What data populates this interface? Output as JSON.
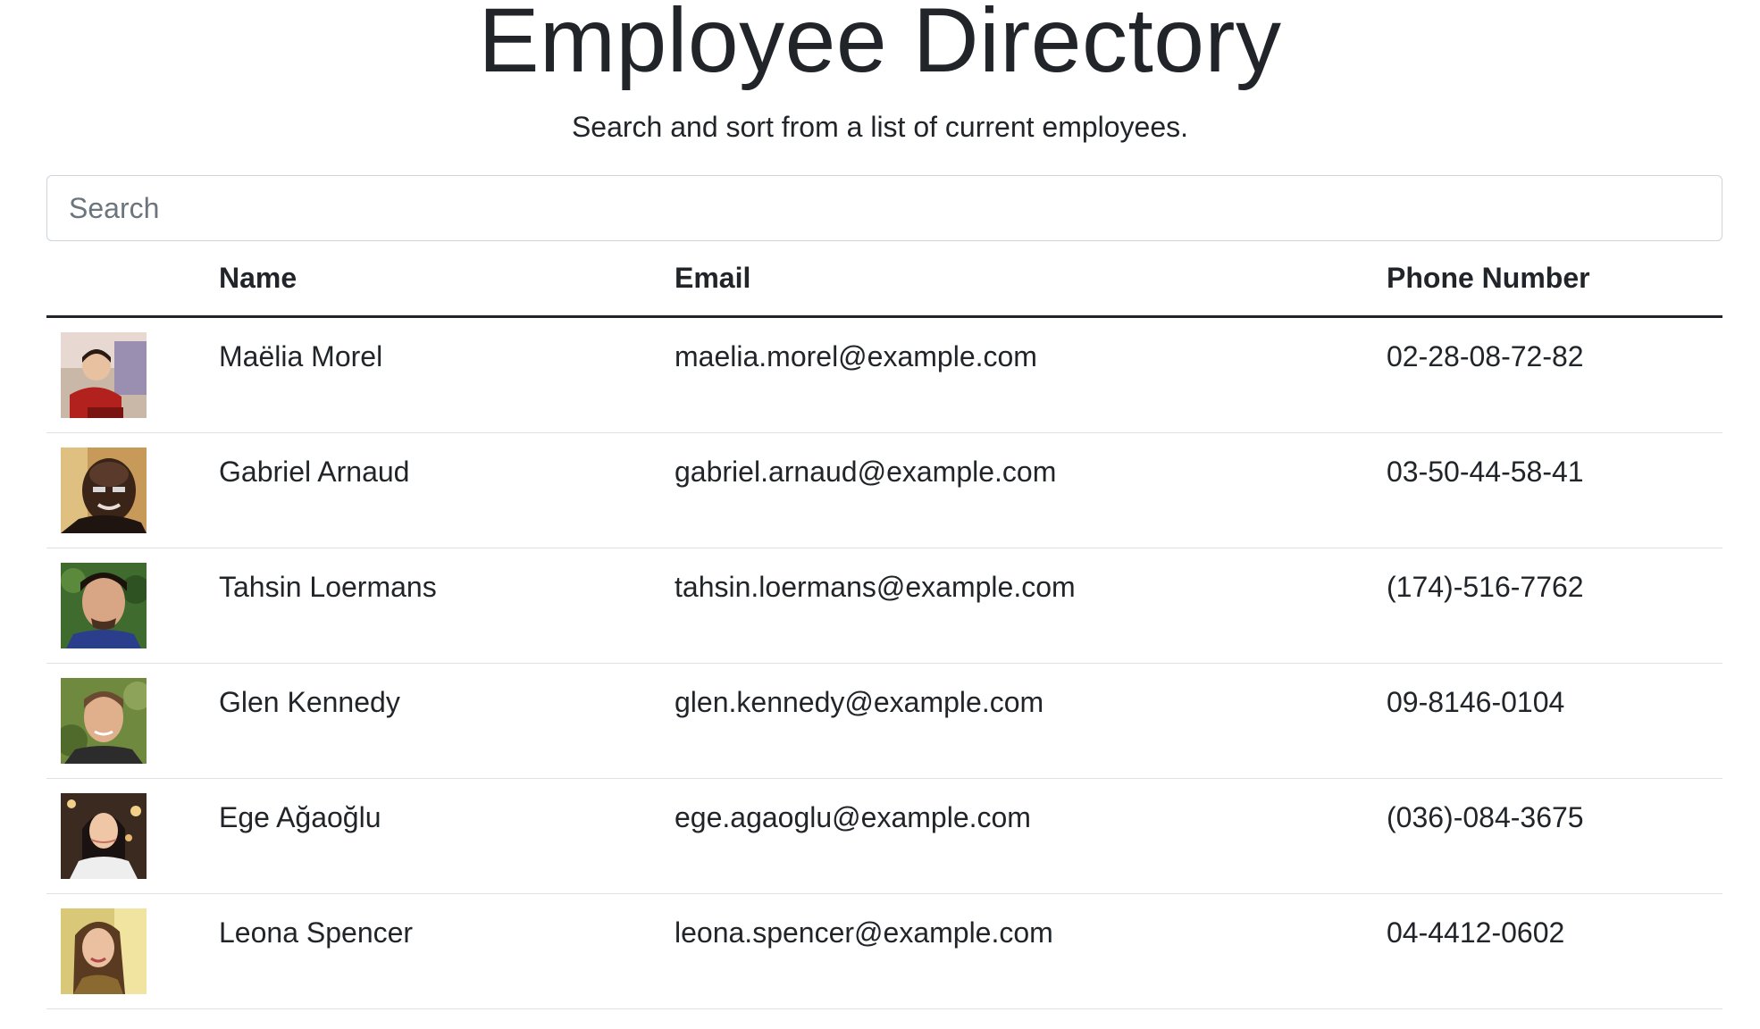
{
  "header": {
    "title": "Employee Directory",
    "subtitle": "Search and sort from a list of current employees."
  },
  "search": {
    "placeholder": "Search",
    "value": ""
  },
  "table": {
    "columns": [
      "",
      "Name",
      "Email",
      "Phone Number"
    ],
    "rows": [
      {
        "name": "Maëlia Morel",
        "email": "maelia.morel@example.com",
        "phone": "02-28-08-72-82"
      },
      {
        "name": "Gabriel Arnaud",
        "email": "gabriel.arnaud@example.com",
        "phone": "03-50-44-58-41"
      },
      {
        "name": "Tahsin Loermans",
        "email": "tahsin.loermans@example.com",
        "phone": "(174)-516-7762"
      },
      {
        "name": "Glen Kennedy",
        "email": "glen.kennedy@example.com",
        "phone": "09-8146-0104"
      },
      {
        "name": "Ege Ağaoğlu",
        "email": "ege.agaoglu@example.com",
        "phone": "(036)-084-3675"
      },
      {
        "name": "Leona Spencer",
        "email": "leona.spencer@example.com",
        "phone": "04-4412-0602"
      }
    ]
  }
}
